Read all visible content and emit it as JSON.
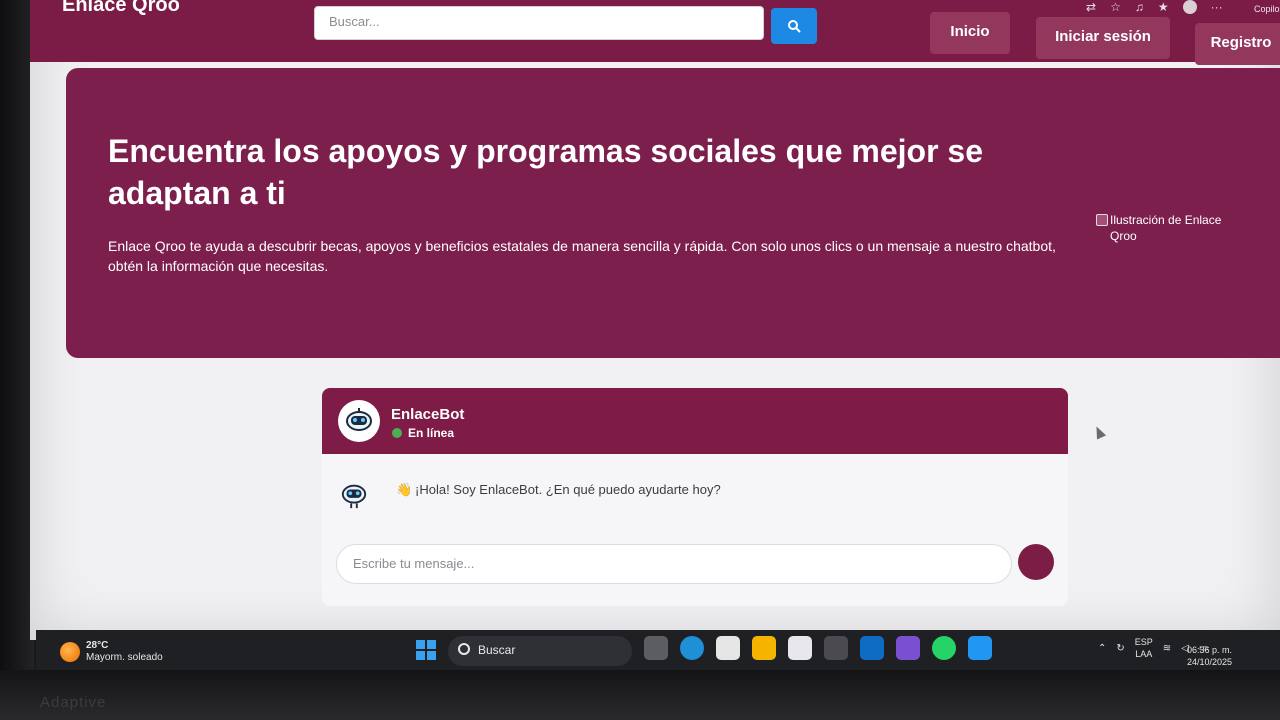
{
  "navbar": {
    "brand": "Enlace Qroo",
    "search_placeholder": "Buscar...",
    "buttons": [
      "Inicio",
      "Iniciar sesión",
      "Registro"
    ],
    "browser_extra_label": "Copilo"
  },
  "hero": {
    "title": "Encuentra los apoyos y programas sociales que mejor se adaptan a ti",
    "text": "Enlace Qroo te ayuda a descubrir becas, apoyos y beneficios estatales de manera sencilla y rápida. Con solo unos clics o un mensaje a nuestro chatbot, obtén la información que necesitas.",
    "image_alt": "Ilustración de Enlace Qroo"
  },
  "chat": {
    "bot_name": "EnlaceBot",
    "status": "En línea",
    "messages": [
      {
        "sender": "bot",
        "icon": "waving-hand",
        "text": "¡Hola! Soy EnlaceBot. ¿En qué puedo ayudarte hoy?"
      }
    ],
    "input_placeholder": "Escribe tu mensaje..."
  },
  "taskbar": {
    "weather_temp": "28°C",
    "weather_desc": "Mayorm. soleado",
    "search_label": "Buscar",
    "lang_top": "ESP",
    "lang_bottom": "LAA",
    "time": "06:36 p. m.",
    "date": "24/10/2025"
  },
  "bezel": {
    "label": "Adaptive"
  },
  "colors": {
    "primary": "#7a1c45",
    "accent_blue": "#1e88e5",
    "online_green": "#4caf50"
  }
}
